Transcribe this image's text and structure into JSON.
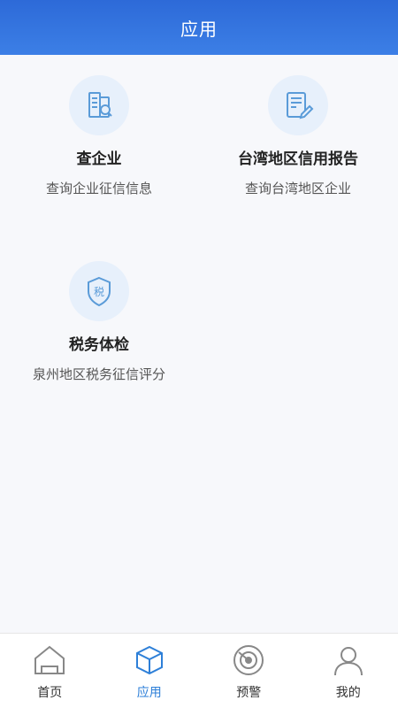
{
  "header": {
    "title": "应用"
  },
  "apps": [
    {
      "name": "查企业",
      "desc": "查询企业征信信息"
    },
    {
      "name": "台湾地区信用报告",
      "desc": "查询台湾地区企业"
    },
    {
      "name": "税务体检",
      "desc": "泉州地区税务征信评分",
      "icon_text": "税"
    }
  ],
  "tabs": [
    {
      "label": "首页",
      "icon": "home-icon"
    },
    {
      "label": "应用",
      "icon": "box-icon",
      "active": true
    },
    {
      "label": "预警",
      "icon": "radar-icon"
    },
    {
      "label": "我的",
      "icon": "user-icon"
    }
  ],
  "colors": {
    "header": "#3477e0",
    "accent": "#2d7fd8",
    "icon_bg": "#e7f0fb",
    "icon_stroke": "#5a9bd8"
  }
}
